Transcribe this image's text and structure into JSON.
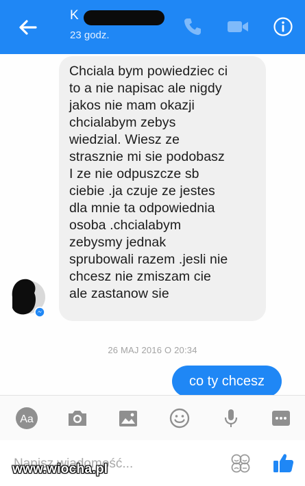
{
  "header": {
    "contact_name_visible": "K",
    "last_active": "23 godz.",
    "icons": [
      "back-arrow-icon",
      "phone-icon",
      "video-camera-icon",
      "info-icon"
    ]
  },
  "messages": {
    "incoming": {
      "lines": [
        "Chciala bym powiedziec ci",
        "to a nie napisac ale nigdy",
        "jakos nie mam okazji",
        "chcialabym zebys",
        "wiedzial. Wiesz ze",
        "strasznie  mi sie podobasz",
        "I ze nie odpuszcze sb",
        "ciebie .ja czuje ze jestes",
        "dla mnie ta odpowiednia",
        "osoba .chcialabym",
        "zebysmy jednak",
        "sprubowali razem .jesli nie",
        "chcesz nie zmiszam cie",
        "ale zastanow sie"
      ]
    },
    "timestamp": "26 MAJ 2016 O 20:34",
    "outgoing": {
      "text": "co ty chcesz"
    }
  },
  "toolbar": {
    "text_style_label": "Aa",
    "icons": [
      "text-style-icon",
      "camera-icon",
      "gallery-icon",
      "emoji-icon",
      "microphone-icon",
      "more-icon"
    ]
  },
  "composer": {
    "placeholder": "Napisz wiadomość...",
    "icons": [
      "sticker-emoji-icon",
      "thumbs-up-icon"
    ]
  },
  "watermark": "www.wiocha.pl",
  "colors": {
    "accent": "#1f87f5",
    "incoming_bubble": "#f0f0f0",
    "toolbar_icon": "#8f8f8f"
  }
}
